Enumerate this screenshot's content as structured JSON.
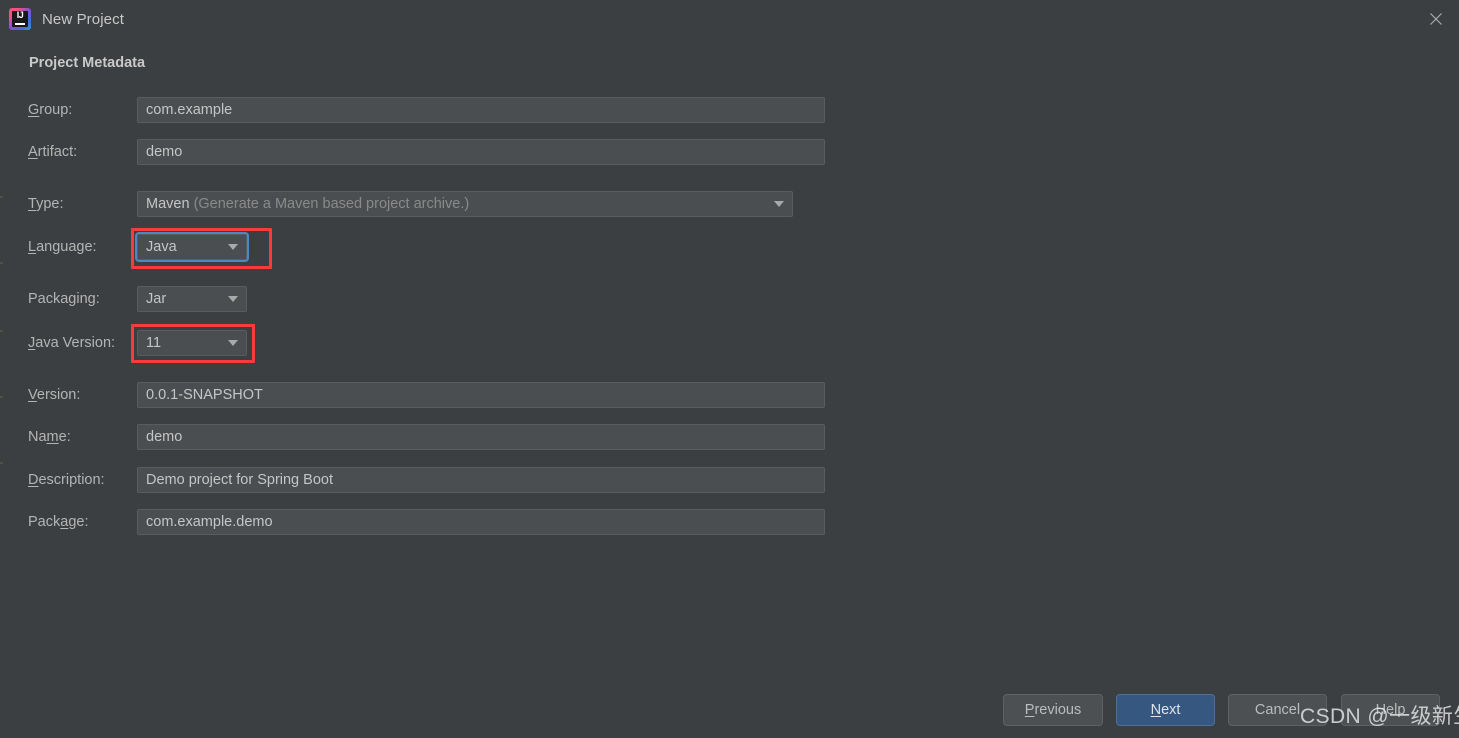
{
  "window": {
    "title": "New Project",
    "logo_icon": "intellij-idea-logo",
    "logo_letters": "IJ",
    "close_icon": "close-icon"
  },
  "section": {
    "heading": "Project Metadata"
  },
  "fields": {
    "group": {
      "label_pre": "",
      "label_mn": "G",
      "label_post": "roup:",
      "value": "com.example"
    },
    "artifact": {
      "label_pre": "",
      "label_mn": "A",
      "label_post": "rtifact:",
      "value": "demo"
    },
    "type": {
      "label_pre": "",
      "label_mn": "T",
      "label_post": "ype:",
      "value": "Maven",
      "hint": "(Generate a Maven based project archive.)"
    },
    "language": {
      "label_pre": "",
      "label_mn": "L",
      "label_post": "anguage:",
      "value": "Java"
    },
    "packaging": {
      "label_pre": "Packaging:",
      "label_mn": "",
      "label_post": "",
      "value": "Jar"
    },
    "java_version": {
      "label_pre": "",
      "label_mn": "J",
      "label_post": "ava Version:",
      "value": "11"
    },
    "version": {
      "label_pre": "",
      "label_mn": "V",
      "label_post": "ersion:",
      "value": "0.0.1-SNAPSHOT"
    },
    "name": {
      "label_pre": "Na",
      "label_mn": "m",
      "label_post": "e:",
      "value": "demo"
    },
    "description": {
      "label_pre": "",
      "label_mn": "D",
      "label_post": "escription:",
      "value": "Demo project for Spring Boot"
    },
    "package": {
      "label_pre": "Pack",
      "label_mn": "a",
      "label_post": "ge:",
      "value": "com.example.demo"
    }
  },
  "buttons": {
    "previous": {
      "pre": "",
      "mn": "P",
      "post": "revious"
    },
    "next": {
      "pre": "",
      "mn": "N",
      "post": "ext"
    },
    "cancel": {
      "pre": "Cancel",
      "mn": "",
      "post": ""
    },
    "help": {
      "pre": "Help",
      "mn": "",
      "post": ""
    }
  },
  "annotations": {
    "color": "#fb3b3b",
    "focus_color": "#4a88c7",
    "highlighted_fields": [
      "language",
      "java_version"
    ]
  },
  "watermark": {
    "text": "CSDN @一级新生"
  },
  "colors": {
    "dialog_background": "#3c3f41",
    "input_background": "#4b4e50",
    "primary_button": "#365880",
    "text": "#bbbbbb"
  }
}
